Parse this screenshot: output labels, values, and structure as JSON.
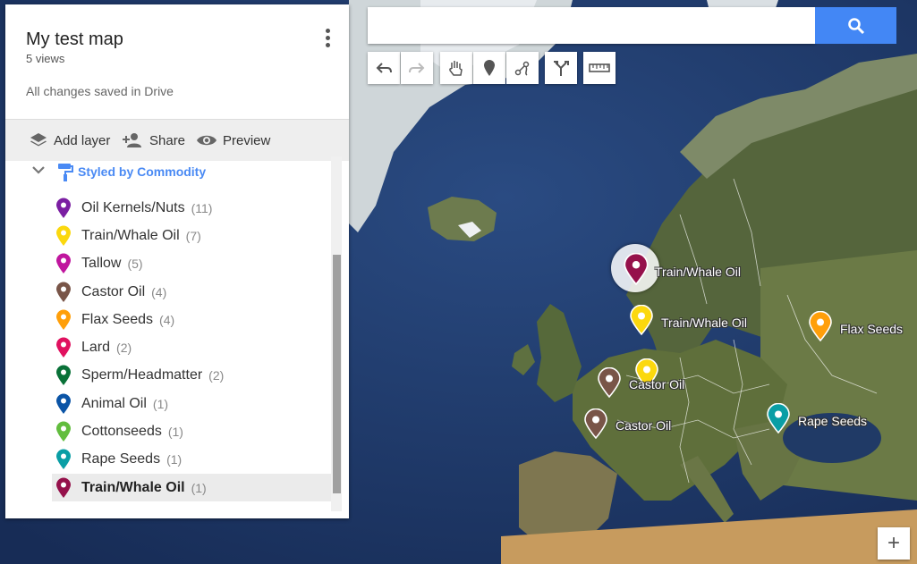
{
  "map_panel": {
    "title": "My test map",
    "views": "5 views",
    "saved_status": "All changes saved in Drive",
    "toolbar": {
      "add_layer": "Add layer",
      "share": "Share",
      "preview": "Preview"
    },
    "layer": {
      "style_label": "Styled by Commodity",
      "legend": [
        {
          "name": "Oil Kernels/Nuts",
          "count": "(11)",
          "color": "#7b1fa2"
        },
        {
          "name": "Train/Whale Oil",
          "count": "(7)",
          "color": "#fbd80e"
        },
        {
          "name": "Tallow",
          "count": "(5)",
          "color": "#c0169e"
        },
        {
          "name": "Castor Oil",
          "count": "(4)",
          "color": "#795548"
        },
        {
          "name": "Flax Seeds",
          "count": "(4)",
          "color": "#ff9f0a"
        },
        {
          "name": "Lard",
          "count": "(2)",
          "color": "#e0115f"
        },
        {
          "name": "Sperm/Headmatter",
          "count": "(2)",
          "color": "#097138"
        },
        {
          "name": "Animal Oil",
          "count": "(1)",
          "color": "#0b54a6"
        },
        {
          "name": "Cottonseeds",
          "count": "(1)",
          "color": "#62bd3e"
        },
        {
          "name": "Rape Seeds",
          "count": "(1)",
          "color": "#0a9ea5"
        },
        {
          "name": "Train/Whale Oil",
          "count": "(1)",
          "color": "#95114b"
        }
      ]
    }
  },
  "search": {
    "placeholder": ""
  },
  "map_markers": [
    {
      "label": "Train/Whale Oil",
      "color": "#95114b",
      "icon": "map-pin-icon"
    },
    {
      "label": "Train/Whale Oil",
      "color": "#fbd80e",
      "icon": "map-pin-icon"
    },
    {
      "label": "Flax Seeds",
      "color": "#ff9f0a",
      "icon": "map-pin-icon"
    },
    {
      "label": "Castor Oil",
      "color": "#fbd80e",
      "icon": "map-pin-icon"
    },
    {
      "label": "Castor Oil",
      "color": "#795548",
      "icon": "map-pin-icon"
    },
    {
      "label": "Rape Seeds",
      "color": "#0a9ea5",
      "icon": "map-pin-icon"
    }
  ],
  "zoom": {
    "in_label": "+"
  }
}
